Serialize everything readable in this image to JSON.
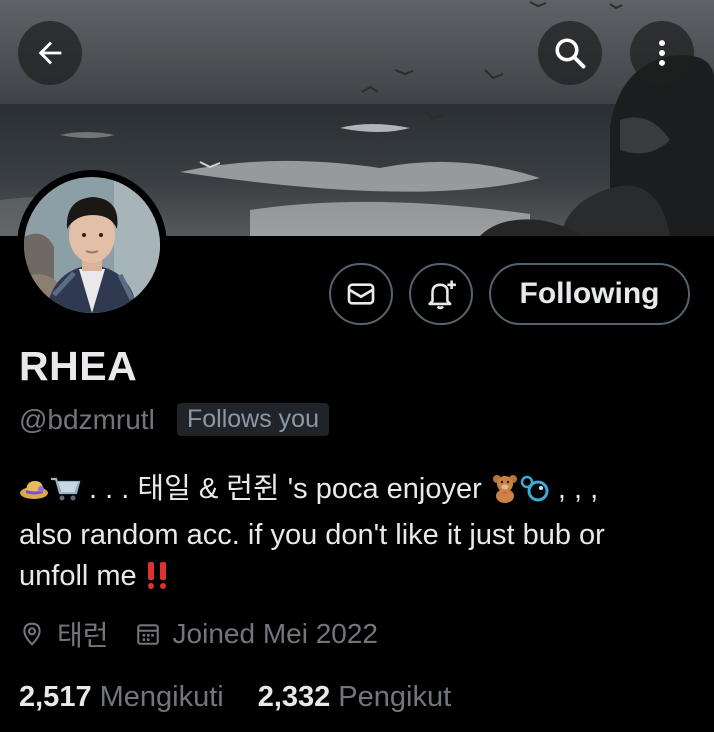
{
  "header": {
    "back_icon": "arrow-left-icon",
    "search_icon": "search-icon",
    "more_icon": "more-vertical-icon"
  },
  "profile": {
    "display_name": "RHEA",
    "handle": "@bdzmrutl",
    "follows_you": "Follows you",
    "bio": {
      "line1_text": " . . . 태일 & 런쥔 's poca enjoyer ",
      "line1_end": " , , ,",
      "line2": "also random acc. if you don't like it just bub or",
      "line3": "unfoll me "
    },
    "location": "태런",
    "joined": "Joined Mei 2022"
  },
  "actions": {
    "message_icon": "mail-icon",
    "notify_icon": "bell-plus-icon",
    "following_label": "Following"
  },
  "stats": {
    "following_count": "2,517",
    "following_label": "Mengikuti",
    "followers_count": "2,332",
    "followers_label": "Pengikut"
  },
  "colors": {
    "background": "#000000",
    "primary_text": "#e7e9ea",
    "secondary_text": "#71767b",
    "border": "#536471",
    "badge_bg": "#202327"
  }
}
